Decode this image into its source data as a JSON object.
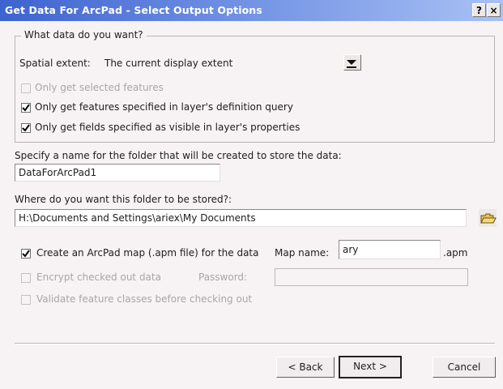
{
  "window": {
    "title": "Get Data For ArcPad - Select Output Options",
    "help_label": "?",
    "close_label": "×"
  },
  "group": {
    "legend": "What data do you want?",
    "spatial_label": "Spatial extent:",
    "spatial_value": "The current display extent",
    "checkboxes": [
      {
        "label": "Only get selected features",
        "checked": false,
        "enabled": false
      },
      {
        "label": "Only get features specified in layer's definition query",
        "checked": true,
        "enabled": true
      },
      {
        "label": "Only get fields specified as visible in layer's properties",
        "checked": true,
        "enabled": true
      }
    ]
  },
  "folder": {
    "name_label": "Specify a name for the folder that will be created to store the data:",
    "name_value": "DataForArcPad1",
    "location_label": "Where do you want this folder to be stored?:",
    "location_value": "H:\\Documents and Settings\\ariex\\My Documents"
  },
  "options": {
    "create_map_label": "Create an ArcPad map (.apm file) for the data",
    "create_map_checked": true,
    "map_name_label": "Map name:",
    "map_name_value": "ary",
    "map_ext": ".apm",
    "encrypt_label": "Encrypt checked out data",
    "encrypt_checked": false,
    "password_label": "Password:",
    "password_value": "",
    "validate_label": "Validate feature classes before checking out",
    "validate_checked": false
  },
  "buttons": {
    "back": "< Back",
    "next": "Next >",
    "cancel": "Cancel"
  }
}
